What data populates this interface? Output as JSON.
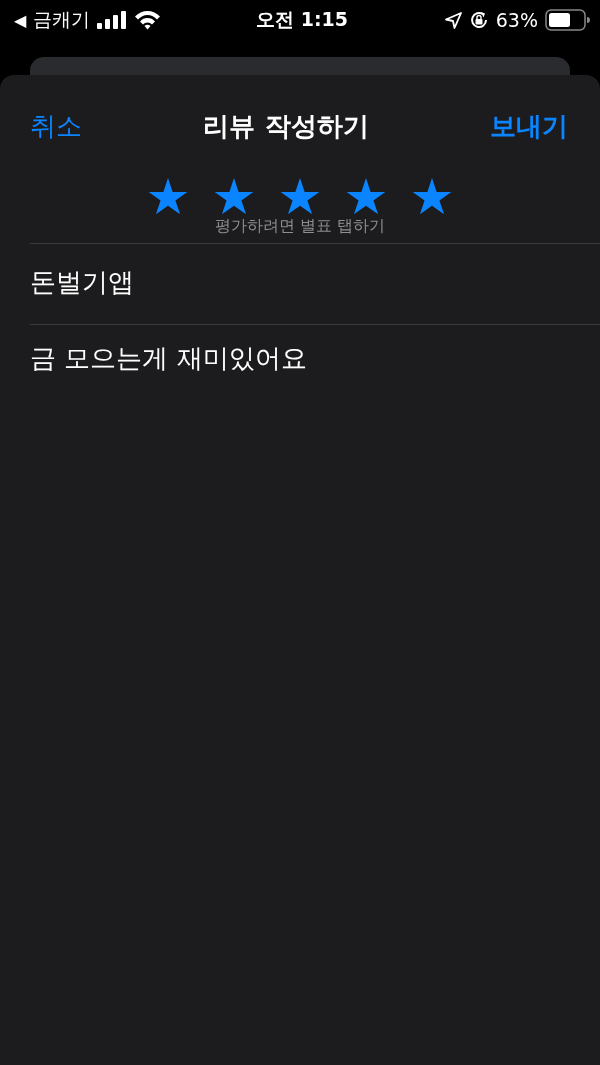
{
  "status_bar": {
    "back_glyph": "◀",
    "back_app": "금캐기",
    "time": "오전 1:15",
    "battery": "63%"
  },
  "header": {
    "cancel": "취소",
    "title": "리뷰 작성하기",
    "send": "보내기"
  },
  "rating": {
    "stars": 5,
    "hint": "평가하려면 별표 탭하기"
  },
  "review": {
    "title": "돈벌기앱",
    "body": "금 모으는게 재미있어요"
  }
}
